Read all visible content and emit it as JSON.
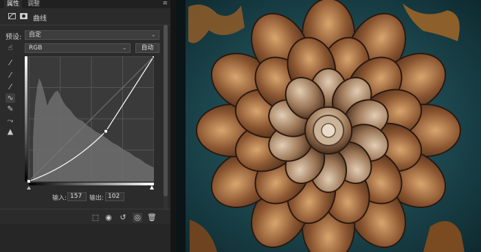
{
  "tabs": [
    "属性",
    "调整"
  ],
  "menu_icon": "≡",
  "header": {
    "title": "曲线",
    "icons": [
      "curves-layer-icon",
      "mask-icon"
    ]
  },
  "preset": {
    "label": "预设:",
    "value": "自定"
  },
  "channel": {
    "value": "RGB",
    "auto_label": "自动"
  },
  "tools": [
    "hand-target-icon",
    "eyedropper-black-icon",
    "eyedropper-gray-icon",
    "eyedropper-white-icon",
    "curve-points-icon",
    "pencil-icon",
    "smooth-icon",
    "clipping-warning-icon"
  ],
  "io": {
    "input_label": "输入:",
    "input_value": "157",
    "output_label": "输出:",
    "output_value": "102"
  },
  "curve": {
    "input": 157,
    "output": 102,
    "range": [
      0,
      255
    ]
  },
  "bottom_icons": [
    "clip-to-layer-icon",
    "view-previous-icon",
    "reset-icon",
    "visibility-icon",
    "delete-icon"
  ],
  "colors": {
    "panel": "#2b2b2b",
    "accent": "#ffffff",
    "teal": "#1f4f57",
    "copper": "#b0632a"
  }
}
